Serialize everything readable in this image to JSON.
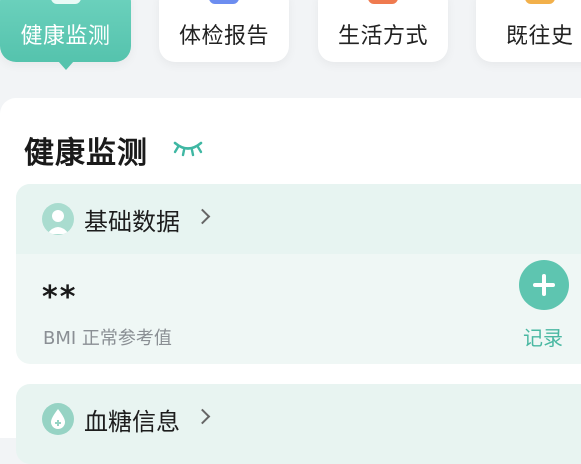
{
  "tabs": [
    {
      "label": "健康监测",
      "active": true,
      "icon": "heart-monitor-icon"
    },
    {
      "label": "体检报告",
      "active": false,
      "icon": "report-icon",
      "icon_color": "#6c8df0"
    },
    {
      "label": "生活方式",
      "active": false,
      "icon": "lifestyle-icon",
      "icon_color": "#ef7a4f"
    },
    {
      "label": "既往史",
      "active": false,
      "icon": "history-icon",
      "icon_color": "#f2b04a"
    }
  ],
  "section": {
    "title": "健康监测",
    "visibility_icon": "eye-closed-icon"
  },
  "basic_data": {
    "title": "基础数据",
    "value": "**",
    "caption": "BMI 正常参考值",
    "add_icon": "plus-icon",
    "record_label": "记录"
  },
  "blood_sugar": {
    "title": "血糖信息"
  },
  "colors": {
    "accent": "#5ec5b0",
    "card_bg": "#eff7f5"
  }
}
